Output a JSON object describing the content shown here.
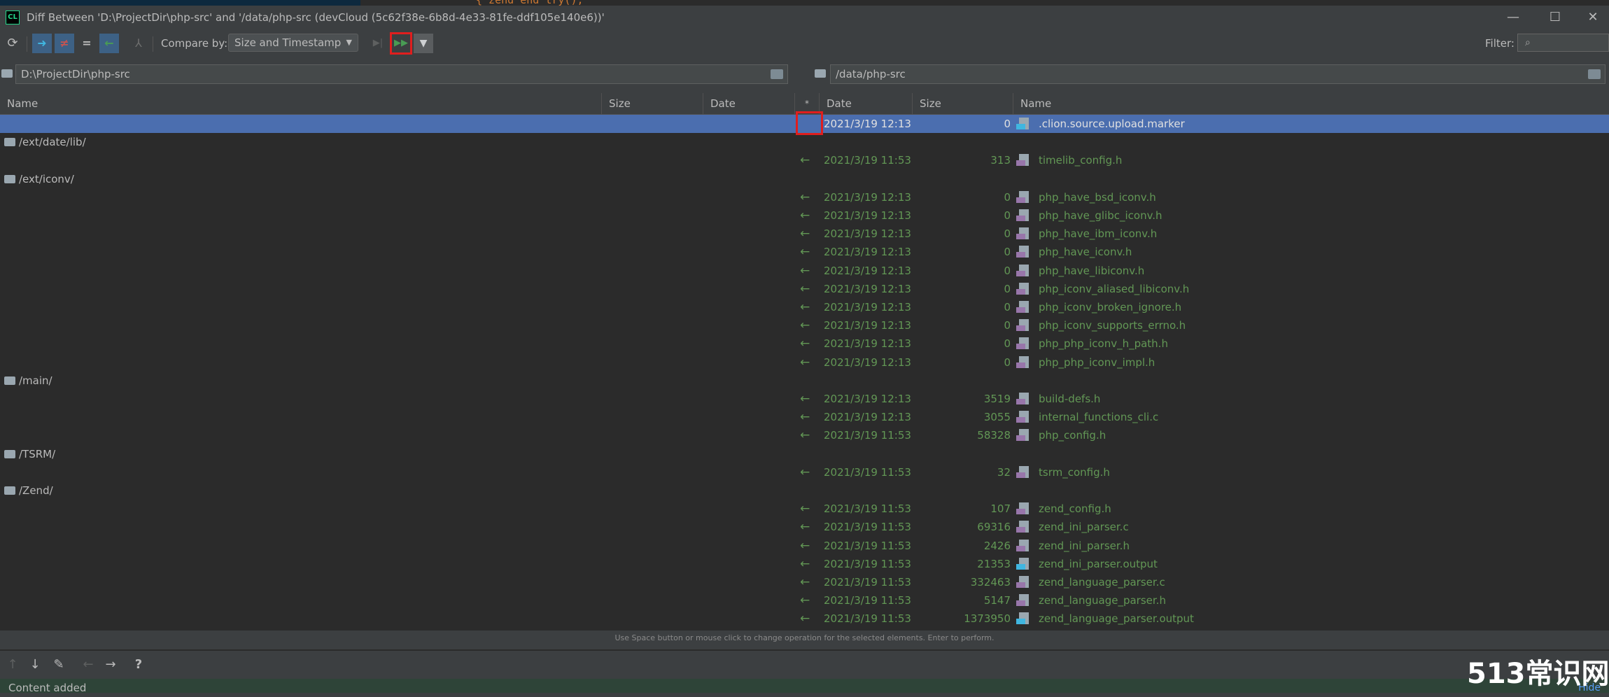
{
  "window": {
    "title": "Diff Between 'D:\\ProjectDir\\php-src' and '/data/php-src (devCloud (5c62f38e-6b8d-4e33-81fe-ddf105e140e6))'",
    "app_icon_text": "CL",
    "minimize": "—",
    "maximize": "☐",
    "close": "✕"
  },
  "background_code": "{  zend_end_try();",
  "toolbar": {
    "compare_by_label": "Compare by:",
    "compare_by_value": "Size and Timestamp",
    "filter_label": "Filter:",
    "icons": [
      "refresh-icon",
      "right-arrow-icon",
      "not-equal-icon",
      "equal-icon",
      "left-arrow-icon",
      "merge-icon",
      "step-forward-icon",
      "fast-forward-icon",
      "funnel-icon"
    ]
  },
  "left_path": "D:\\ProjectDir\\php-src",
  "right_path": "/data/php-src",
  "columns": {
    "left_name": "Name",
    "left_size": "Size",
    "left_date": "Date",
    "op": "*",
    "right_date": "Date",
    "right_size": "Size",
    "right_name": "Name"
  },
  "rows": [
    {
      "type": "file",
      "selected": true,
      "op": "",
      "date": "2021/3/19 12:13",
      "size": "0",
      "name": ".clion.source.upload.marker",
      "icon": "marker-file-icon"
    },
    {
      "type": "folder",
      "name": "/ext/date/lib/"
    },
    {
      "type": "file",
      "op": "←",
      "date": "2021/3/19 11:53",
      "size": "313",
      "name": "timelib_config.h",
      "icon": "header-file-icon"
    },
    {
      "type": "folder",
      "name": "/ext/iconv/"
    },
    {
      "type": "file",
      "op": "←",
      "date": "2021/3/19 12:13",
      "size": "0",
      "name": "php_have_bsd_iconv.h",
      "icon": "header-file-icon"
    },
    {
      "type": "file",
      "op": "←",
      "date": "2021/3/19 12:13",
      "size": "0",
      "name": "php_have_glibc_iconv.h",
      "icon": "header-file-icon"
    },
    {
      "type": "file",
      "op": "←",
      "date": "2021/3/19 12:13",
      "size": "0",
      "name": "php_have_ibm_iconv.h",
      "icon": "header-file-icon"
    },
    {
      "type": "file",
      "op": "←",
      "date": "2021/3/19 12:13",
      "size": "0",
      "name": "php_have_iconv.h",
      "icon": "header-file-icon"
    },
    {
      "type": "file",
      "op": "←",
      "date": "2021/3/19 12:13",
      "size": "0",
      "name": "php_have_libiconv.h",
      "icon": "header-file-icon"
    },
    {
      "type": "file",
      "op": "←",
      "date": "2021/3/19 12:13",
      "size": "0",
      "name": "php_iconv_aliased_libiconv.h",
      "icon": "header-file-icon"
    },
    {
      "type": "file",
      "op": "←",
      "date": "2021/3/19 12:13",
      "size": "0",
      "name": "php_iconv_broken_ignore.h",
      "icon": "header-file-icon"
    },
    {
      "type": "file",
      "op": "←",
      "date": "2021/3/19 12:13",
      "size": "0",
      "name": "php_iconv_supports_errno.h",
      "icon": "header-file-icon"
    },
    {
      "type": "file",
      "op": "←",
      "date": "2021/3/19 12:13",
      "size": "0",
      "name": "php_php_iconv_h_path.h",
      "icon": "header-file-icon"
    },
    {
      "type": "file",
      "op": "←",
      "date": "2021/3/19 12:13",
      "size": "0",
      "name": "php_php_iconv_impl.h",
      "icon": "header-file-icon"
    },
    {
      "type": "folder",
      "name": "/main/"
    },
    {
      "type": "file",
      "op": "←",
      "date": "2021/3/19 12:13",
      "size": "3519",
      "name": "build-defs.h",
      "icon": "header-file-icon"
    },
    {
      "type": "file",
      "op": "←",
      "date": "2021/3/19 12:13",
      "size": "3055",
      "name": "internal_functions_cli.c",
      "icon": "c-file-icon"
    },
    {
      "type": "file",
      "op": "←",
      "date": "2021/3/19 11:53",
      "size": "58328",
      "name": "php_config.h",
      "icon": "header-file-icon"
    },
    {
      "type": "folder",
      "name": "/TSRM/"
    },
    {
      "type": "file",
      "op": "←",
      "date": "2021/3/19 11:53",
      "size": "32",
      "name": "tsrm_config.h",
      "icon": "header-file-icon"
    },
    {
      "type": "folder",
      "name": "/Zend/"
    },
    {
      "type": "file",
      "op": "←",
      "date": "2021/3/19 11:53",
      "size": "107",
      "name": "zend_config.h",
      "icon": "header-file-icon"
    },
    {
      "type": "file",
      "op": "←",
      "date": "2021/3/19 11:53",
      "size": "69316",
      "name": "zend_ini_parser.c",
      "icon": "c-file-icon"
    },
    {
      "type": "file",
      "op": "←",
      "date": "2021/3/19 11:53",
      "size": "2426",
      "name": "zend_ini_parser.h",
      "icon": "header-file-icon"
    },
    {
      "type": "file",
      "op": "←",
      "date": "2021/3/19 11:53",
      "size": "21353",
      "name": "zend_ini_parser.output",
      "icon": "marker-file-icon"
    },
    {
      "type": "file",
      "op": "←",
      "date": "2021/3/19 11:53",
      "size": "332463",
      "name": "zend_language_parser.c",
      "icon": "c-file-icon"
    },
    {
      "type": "file",
      "op": "←",
      "date": "2021/3/19 11:53",
      "size": "5147",
      "name": "zend_language_parser.h",
      "icon": "header-file-icon"
    },
    {
      "type": "file",
      "op": "←",
      "date": "2021/3/19 11:53",
      "size": "1373950",
      "name": "zend_language_parser.output",
      "icon": "marker-file-icon"
    }
  ],
  "hint": "Use Space button or mouse click to change operation for the selected elements. Enter to perform.",
  "bottom_toolbar": {
    "up": "↑",
    "down": "↓",
    "edit": "✎",
    "back": "←",
    "forward": "→",
    "help": "?"
  },
  "status": {
    "text": "Content added",
    "hide": "Hide"
  },
  "watermark": "513常识网",
  "colors": {
    "selected_row": "#4b6eaf",
    "added_text": "#629755",
    "highlight_box": "#e01e1e"
  }
}
